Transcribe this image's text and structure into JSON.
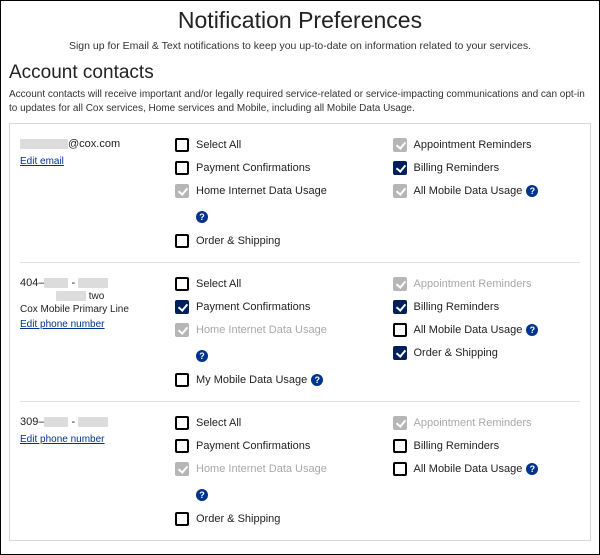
{
  "page": {
    "title": "Notification Preferences",
    "subtitle": "Sign up for Email & Text notifications to keep you up-to-date on information related to your services."
  },
  "section": {
    "heading": "Account contacts",
    "description": "Account contacts will receive important and/or legally required service-related or service-impacting communications and can opt-in to updates for all Cox services, Home services and Mobile, including all Mobile Data Usage."
  },
  "labels": {
    "edit_email": "Edit email",
    "edit_phone": "Edit phone number",
    "select_all": "Select All",
    "payment_confirmations": "Payment Confirmations",
    "home_internet_data": "Home Internet Data Usage",
    "order_shipping": "Order & Shipping",
    "my_mobile_data": "My Mobile Data Usage",
    "appointment_reminders": "Appointment Reminders",
    "billing_reminders": "Billing Reminders",
    "all_mobile_data": "All Mobile Data Usage"
  },
  "contacts": [
    {
      "id": "email1",
      "display_suffix": "@cox.com",
      "sub1": "",
      "sub2": "",
      "edit_key": "edit_email"
    },
    {
      "id": "phone1",
      "display_prefix": "404–",
      "sub1": "two",
      "sub2": "Cox Mobile Primary Line",
      "edit_key": "edit_phone"
    },
    {
      "id": "phone2",
      "display_prefix": "309–",
      "sub1": "",
      "sub2": "",
      "edit_key": "edit_phone"
    }
  ]
}
